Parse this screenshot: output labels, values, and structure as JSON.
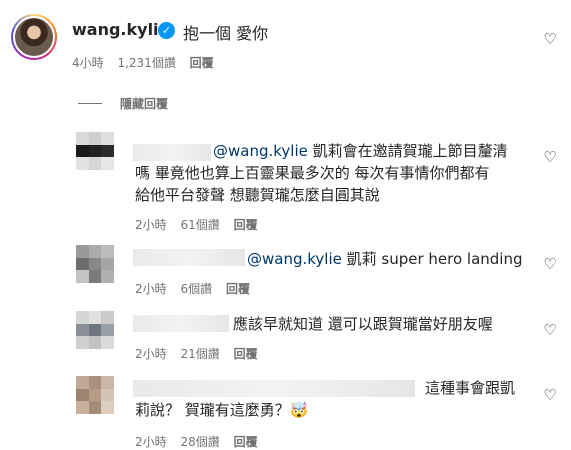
{
  "main": {
    "username": "wang.kylie",
    "text": "抱一個 愛你",
    "time": "4小時",
    "likes": "1,231個讚",
    "reply_label": "回覆"
  },
  "hide_replies_label": "隱藏回覆",
  "replies": [
    {
      "mention": "@wang.kylie",
      "line1_rest": " 凱莉會在邀請賀瓏上節目釐清",
      "line2": "嗎 畢竟他也算上百靈果最多次的 每次有事情你們都有",
      "line3": "給他平台發聲 想聽賀瓏怎麼自圓其說",
      "time": "2小時",
      "likes": "61個讚",
      "reply_label": "回覆"
    },
    {
      "mention": "@wang.kylie",
      "line1_rest": " 凱莉 super hero landing",
      "time": "2小時",
      "likes": "6個讚",
      "reply_label": "回覆"
    },
    {
      "line1": "應該早就知道 還可以跟賀瓏當好朋友喔",
      "time": "2小時",
      "likes": "21個讚",
      "reply_label": "回覆"
    },
    {
      "line1": "這種事會跟凱",
      "line2": "莉說？ 賀瓏有這麼勇？",
      "emoji": "🤯",
      "time": "2小時",
      "likes": "28個讚",
      "reply_label": "回覆"
    }
  ],
  "icons": {
    "heart": "heart-outline-icon",
    "verified": "verified-badge-icon"
  },
  "colors": {
    "mention": "#00376b",
    "verified": "#0095f6",
    "meta_text": "#737373"
  }
}
